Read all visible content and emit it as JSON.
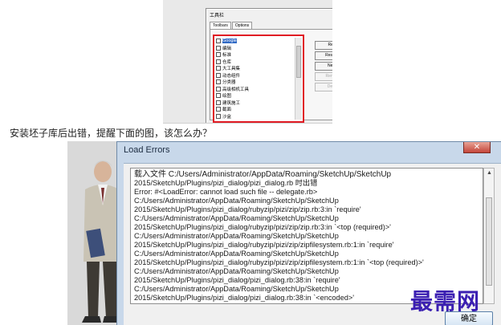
{
  "toolbar_dialog": {
    "title": "工具栏",
    "close_glyph": "✕",
    "tabs": [
      "Toolbars",
      "Options"
    ],
    "items": [
      "Google",
      "编辑",
      "标准",
      "仓库",
      "大工具集",
      "动态组件",
      "分类器",
      "高级相机工具",
      "绘图",
      "建筑施工",
      "截面",
      "沙盒",
      "实体工具"
    ],
    "buttons": [
      {
        "label": "Reset",
        "enabled": true
      },
      {
        "label": "Reset All",
        "enabled": true
      },
      {
        "label": "New...",
        "enabled": true
      },
      {
        "label": "Rename",
        "enabled": false
      },
      {
        "label": "Delete",
        "enabled": false
      }
    ]
  },
  "question": "安装坯子库后出错，提醒下面的图，该怎么办？",
  "load_errors": {
    "title": "Load Errors",
    "close_glyph": "✕",
    "lines": [
      "载入文件 C:/Users/Administrator/AppData/Roaming/SketchUp/SketchUp",
      "2015/SketchUp/Plugins/pizi_dialog/pizi_dialog.rb 时出错",
      "Error: #<LoadError: cannot load such file -- delegate.rb>",
      "C:/Users/Administrator/AppData/Roaming/SketchUp/SketchUp",
      "2015/SketchUp/Plugins/pizi_dialog/rubyzip/pizi/zip/zip.rb:3:in `require'",
      "C:/Users/Administrator/AppData/Roaming/SketchUp/SketchUp",
      "2015/SketchUp/Plugins/pizi_dialog/rubyzip/pizi/zip/zip.rb:3:in `<top (required)>'",
      "C:/Users/Administrator/AppData/Roaming/SketchUp/SketchUp",
      "2015/SketchUp/Plugins/pizi_dialog/rubyzip/pizi/zip/zipfilesystem.rb:1:in `require'",
      "C:/Users/Administrator/AppData/Roaming/SketchUp/SketchUp",
      "2015/SketchUp/Plugins/pizi_dialog/rubyzip/pizi/zip/zipfilesystem.rb:1:in `<top (required)>'",
      "C:/Users/Administrator/AppData/Roaming/SketchUp/SketchUp",
      "2015/SketchUp/Plugins/pizi_dialog/pizi_dialog.rb:38:in `require'",
      "C:/Users/Administrator/AppData/Roaming/SketchUp/SketchUp",
      "2015/SketchUp/Plugins/pizi_dialog/pizi_dialog.rb:38:in `<encoded>'"
    ],
    "ok_label": "确定"
  },
  "watermark": "最需网"
}
